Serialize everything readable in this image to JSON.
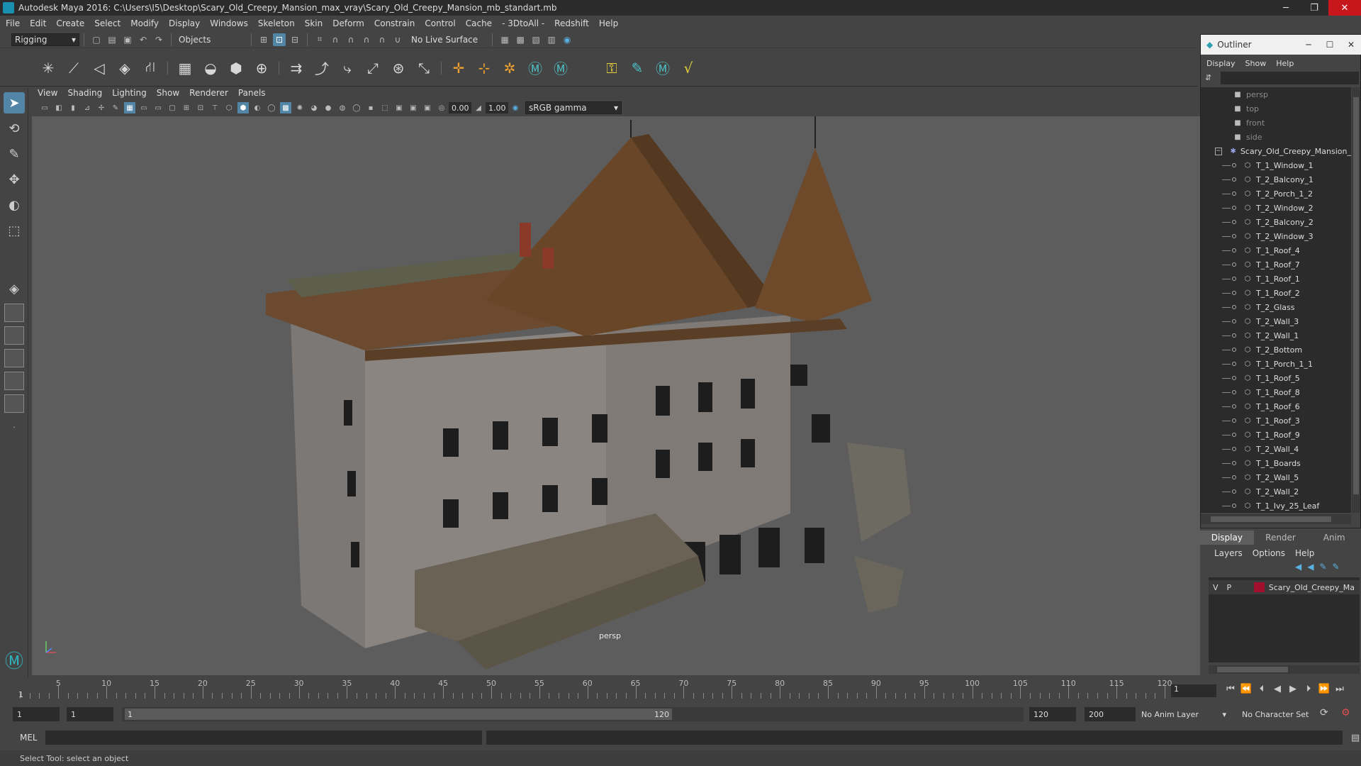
{
  "window": {
    "title": "Autodesk Maya 2016: C:\\Users\\I5\\Desktop\\Scary_Old_Creepy_Mansion_max_vray\\Scary_Old_Creepy_Mansion_mb_standart.mb",
    "minimize": "─",
    "restore": "❐",
    "close": "✕"
  },
  "menubar": [
    "File",
    "Edit",
    "Create",
    "Select",
    "Modify",
    "Display",
    "Windows",
    "Skeleton",
    "Skin",
    "Deform",
    "Constrain",
    "Control",
    "Cache",
    "- 3DtoAll -",
    "Redshift",
    "Help"
  ],
  "statusline": {
    "menuset": "Rigging",
    "selection_mode": "Objects",
    "live_surface": "No Live Surface"
  },
  "viewport": {
    "menus": [
      "View",
      "Shading",
      "Lighting",
      "Show",
      "Renderer",
      "Panels"
    ],
    "exposure": "0.00",
    "gamma": "1.00",
    "color_space": "sRGB gamma",
    "camera_label": "persp"
  },
  "outliner": {
    "title": "Outliner",
    "menus": [
      "Display",
      "Show",
      "Help"
    ],
    "cameras": [
      "persp",
      "top",
      "front",
      "side"
    ],
    "root": "Scary_Old_Creepy_Mansion_",
    "children": [
      "T_1_Window_1",
      "T_2_Balcony_1",
      "T_2_Porch_1_2",
      "T_2_Window_2",
      "T_2_Balcony_2",
      "T_2_Window_3",
      "T_1_Roof_4",
      "T_1_Roof_7",
      "T_1_Roof_1",
      "T_1_Roof_2",
      "T_2_Glass",
      "T_2_Wall_3",
      "T_2_Wall_1",
      "T_2_Bottom",
      "T_1_Porch_1_1",
      "T_1_Roof_5",
      "T_1_Roof_8",
      "T_1_Roof_6",
      "T_1_Roof_3",
      "T_1_Roof_9",
      "T_2_Wall_4",
      "T_1_Boards",
      "T_2_Wall_5",
      "T_2_Wall_2",
      "T_1_Ivy_25_Leaf"
    ]
  },
  "layers": {
    "tabs": [
      "Display",
      "Render",
      "Anim"
    ],
    "menus": [
      "Layers",
      "Options",
      "Help"
    ],
    "row": {
      "v": "V",
      "p": "P",
      "name": "Scary_Old_Creepy_Man",
      "color": "#a0102c"
    }
  },
  "timeline": {
    "ticks": [
      5,
      10,
      15,
      20,
      25,
      30,
      35,
      40,
      45,
      50,
      55,
      60,
      65,
      70,
      75,
      80,
      85,
      90,
      95,
      100,
      105,
      110,
      115,
      120
    ],
    "current_frame": "1",
    "start_marker": "1"
  },
  "range": {
    "start": "1",
    "playback_start": "1",
    "handle_start": "1",
    "handle_end": "120",
    "playback_end": "120",
    "end": "200",
    "anim_layer": "No Anim Layer",
    "character_set": "No Character Set"
  },
  "cmdline": {
    "label": "MEL"
  },
  "helpline": "Select Tool: select an object",
  "colors": {
    "accent": "#5285a6",
    "close": "#c8161d"
  }
}
